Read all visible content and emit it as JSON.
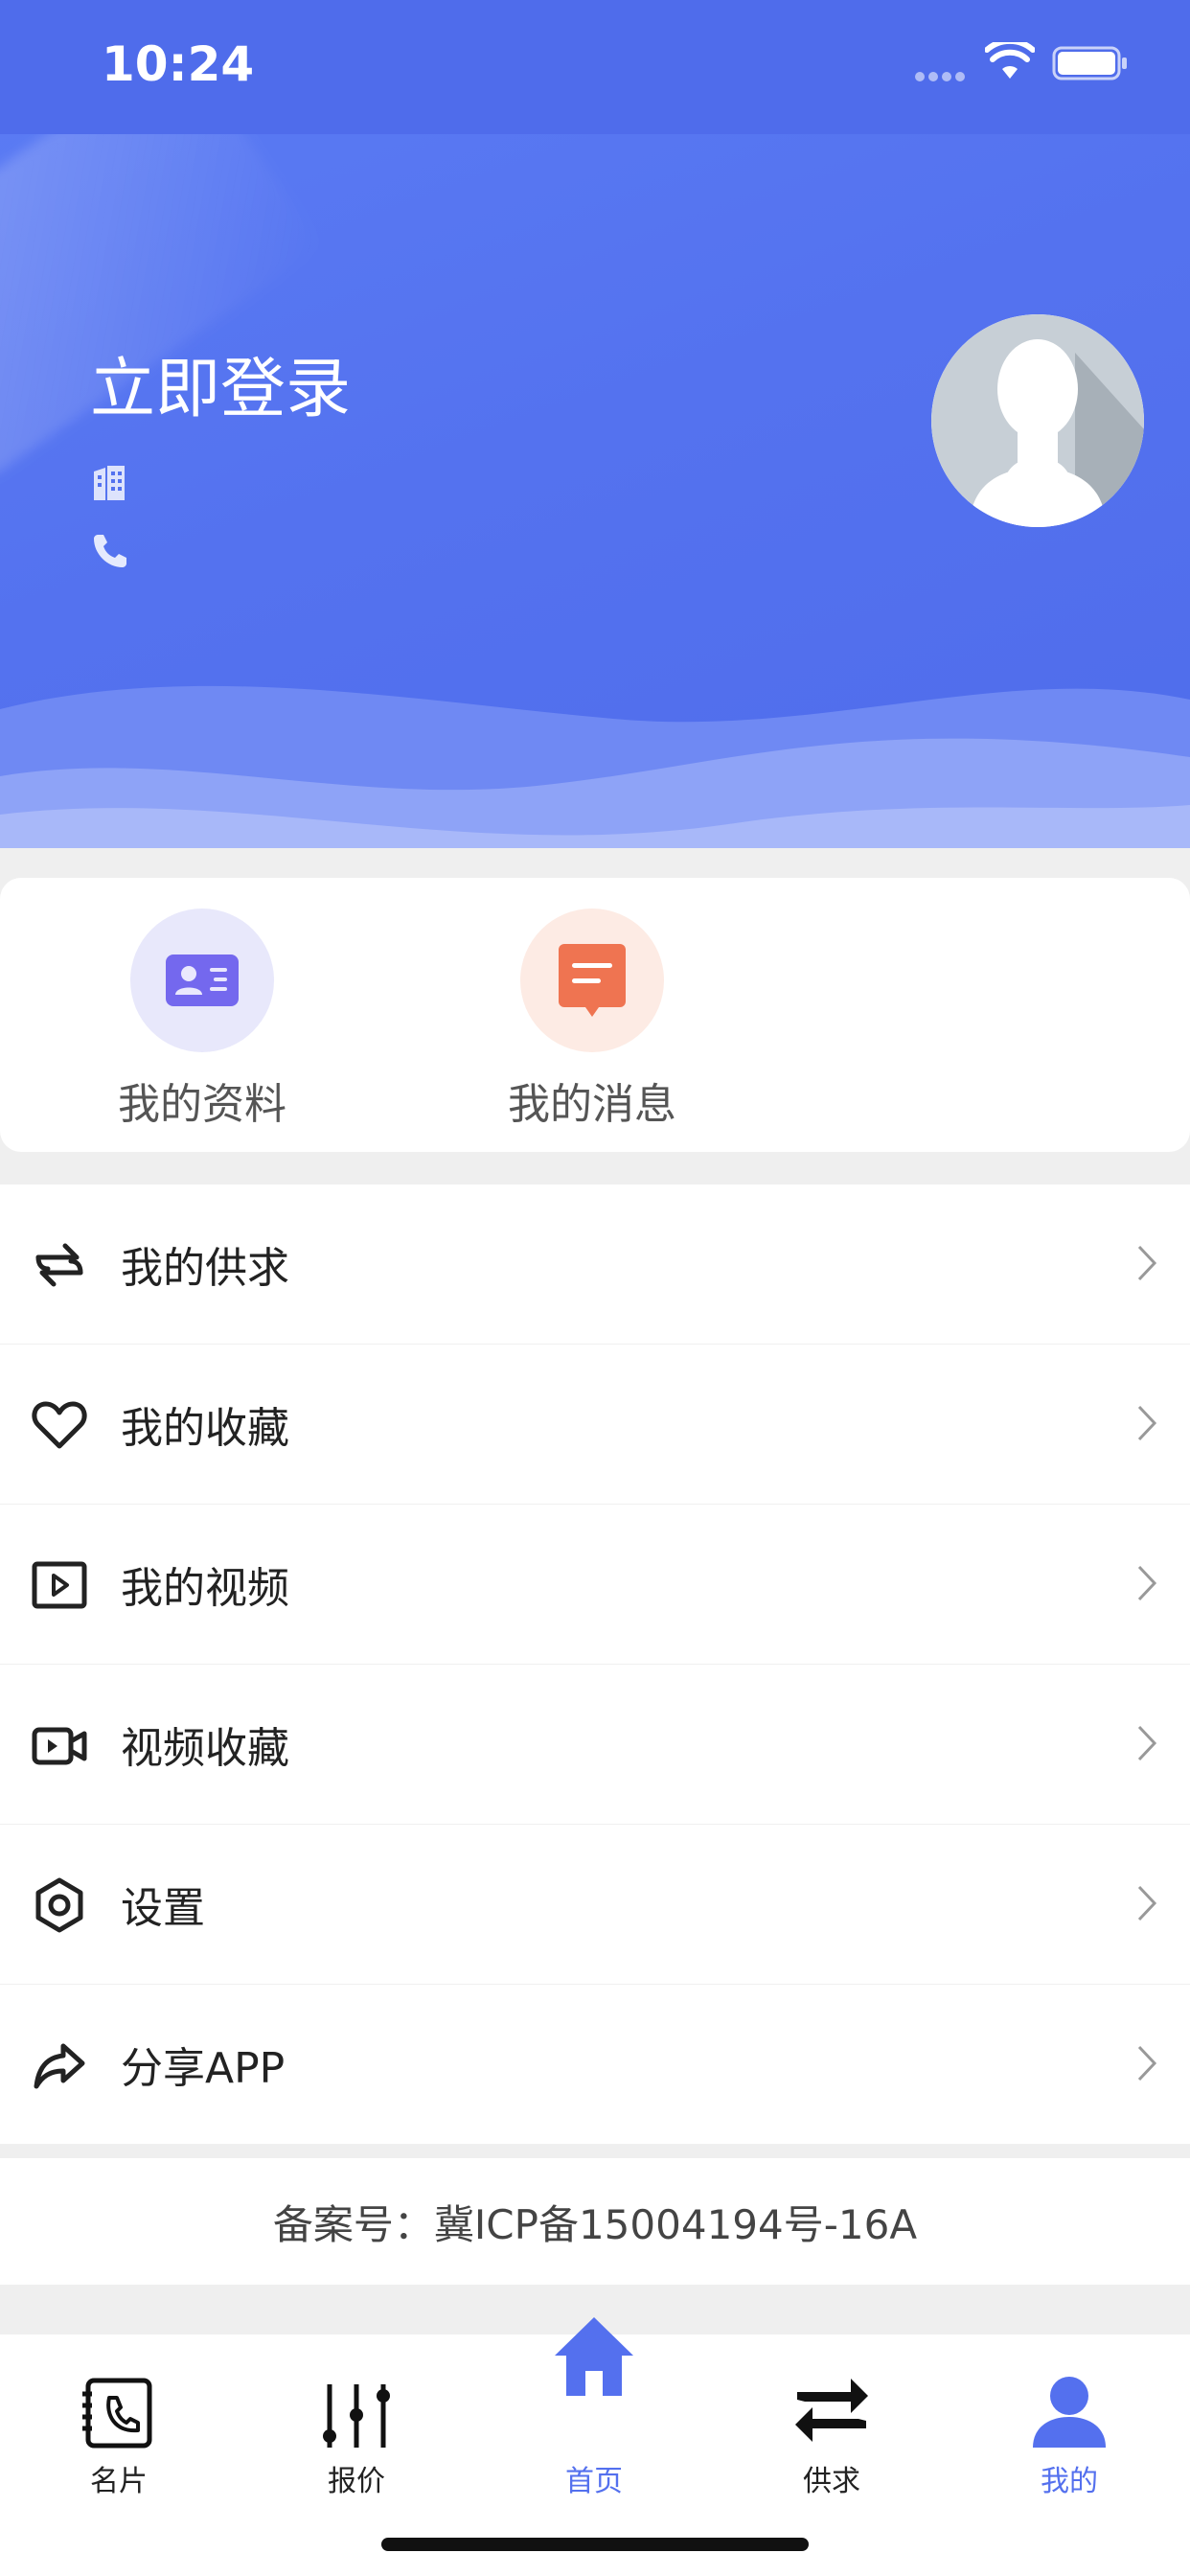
{
  "status_bar": {
    "time": "10:24"
  },
  "profile": {
    "login_label": "立即登录",
    "company_icon": "building-icon",
    "phone_icon": "phone-icon",
    "avatar_icon": "default-avatar"
  },
  "shortcuts": [
    {
      "label": "我的资料",
      "icon": "id-card-icon",
      "color": "#7468ee",
      "bg": "#e8e8fb"
    },
    {
      "label": "我的消息",
      "icon": "message-icon",
      "color": "#ef7451",
      "bg": "#fdebe4"
    }
  ],
  "menu": [
    {
      "label": "我的供求",
      "icon": "swap-icon"
    },
    {
      "label": "我的收藏",
      "icon": "heart-icon"
    },
    {
      "label": "我的视频",
      "icon": "play-icon"
    },
    {
      "label": "视频收藏",
      "icon": "video-camera-icon"
    },
    {
      "label": "设置",
      "icon": "settings-hex-icon"
    },
    {
      "label": "分享APP",
      "icon": "share-icon"
    }
  ],
  "filing": {
    "text": "备案号：冀ICP备15004194号-16A"
  },
  "tabs": [
    {
      "label": "名片",
      "icon": "contact-card-icon",
      "active": false
    },
    {
      "label": "报价",
      "icon": "sliders-icon",
      "active": false
    },
    {
      "label": "首页",
      "icon": "home-icon",
      "active": false
    },
    {
      "label": "供求",
      "icon": "exchange-icon",
      "active": false
    },
    {
      "label": "我的",
      "icon": "user-icon",
      "active": true
    }
  ],
  "colors": {
    "brand": "#5470ee",
    "accent_orange": "#ef7451",
    "accent_purple": "#7468ee"
  }
}
